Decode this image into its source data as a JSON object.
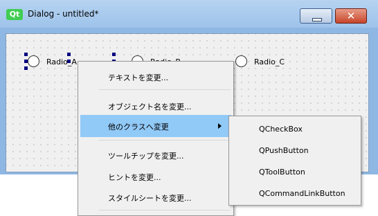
{
  "window": {
    "logo_text": "Qt",
    "title": "Dialog - untitled*",
    "close_glyph": "✕"
  },
  "radios": [
    {
      "label": "Radio_A"
    },
    {
      "label": "Radio_B"
    },
    {
      "label": "Radio_C"
    }
  ],
  "context_menu": {
    "items": [
      {
        "label": "テキストを変更..."
      },
      {
        "label": "オブジェクト名を変更..."
      },
      {
        "label": "他のクラスへ変更",
        "has_submenu": true
      },
      {
        "label": "ツールチップを変更..."
      },
      {
        "label": "ヒントを変更..."
      },
      {
        "label": "スタイルシートを変更..."
      }
    ]
  },
  "submenu": {
    "items": [
      {
        "label": "QCheckBox"
      },
      {
        "label": "QPushButton"
      },
      {
        "label": "QToolButton"
      },
      {
        "label": "QCommandLinkButton"
      }
    ]
  },
  "colors": {
    "highlight": "#91c9f7",
    "selection_handle": "#000080",
    "qt_green": "#41cd52"
  }
}
